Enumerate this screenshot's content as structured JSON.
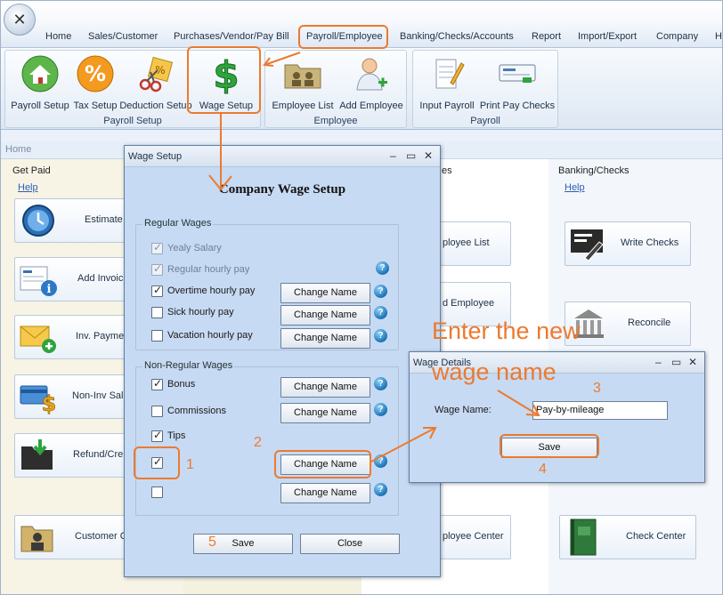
{
  "menubar": {
    "items": [
      "Home",
      "Sales/Customer",
      "Purchases/Vendor/Pay Bill",
      "Payroll/Employee",
      "Banking/Checks/Accounts",
      "Report",
      "Import/Export",
      "Company",
      "H"
    ]
  },
  "ribbon": {
    "groups": [
      {
        "label": "Payroll Setup",
        "buttons": [
          "Payroll Setup",
          "Tax Setup",
          "Deduction Setup",
          "Wage Setup"
        ]
      },
      {
        "label": "Employee",
        "buttons": [
          "Employee List",
          "Add Employee"
        ]
      },
      {
        "label": "Payroll",
        "buttons": [
          "Input Payroll",
          "Print Pay Checks"
        ]
      }
    ]
  },
  "homebar": {
    "label": "Home"
  },
  "main": {
    "get_paid": {
      "heading": "Get Paid",
      "help": "Help",
      "tiles": [
        "Estimate",
        "Add Invoice",
        "Inv. Payment",
        "Non-Inv Sal",
        "Refund/Cre",
        "Customer C"
      ]
    },
    "employee_col": {
      "heading_tail": "es",
      "tiles": [
        "ployee List",
        "d Employee",
        "ployee Center"
      ]
    },
    "banking": {
      "heading": "Banking/Checks",
      "help": "Help",
      "tiles": [
        "Write Checks",
        "Reconcile",
        "Check Center"
      ]
    }
  },
  "wage_setup_dialog": {
    "title": "Wage Setup",
    "heading": "Company Wage Setup",
    "regular_legend": "Regular Wages",
    "regular_rows": [
      {
        "label": "Yealy Salary",
        "checked": true,
        "disabled": true
      },
      {
        "label": "Regular hourly pay",
        "checked": true,
        "disabled": true
      },
      {
        "label": "Overtime hourly pay",
        "checked": true,
        "disabled": false
      },
      {
        "label": "Sick hourly pay",
        "checked": false,
        "disabled": false
      },
      {
        "label": "Vacation hourly pay",
        "checked": false,
        "disabled": false
      }
    ],
    "nonregular_legend": "Non-Regular Wages",
    "nonregular_rows": [
      {
        "label": "Bonus",
        "checked": true
      },
      {
        "label": "Commissions",
        "checked": false
      },
      {
        "label": "Tips",
        "checked": true
      },
      {
        "label": "",
        "checked": true
      },
      {
        "label": "",
        "checked": false
      }
    ],
    "change_name_label": "Change Name",
    "save_label": "Save",
    "close_label": "Close"
  },
  "wage_details_dialog": {
    "title": "Wage Details",
    "field_label": "Wage Name:",
    "field_value": "Pay-by-mileage",
    "save_label": "Save"
  },
  "annotations": {
    "instruction": "Enter the new",
    "instruction_2": "wage name",
    "steps": [
      "1",
      "2",
      "3",
      "4",
      "5"
    ],
    "color": "#ec7a2f"
  },
  "window_controls": {
    "minimize": "–",
    "maximize": "▭",
    "close": "✕"
  },
  "help_glyph": "?"
}
